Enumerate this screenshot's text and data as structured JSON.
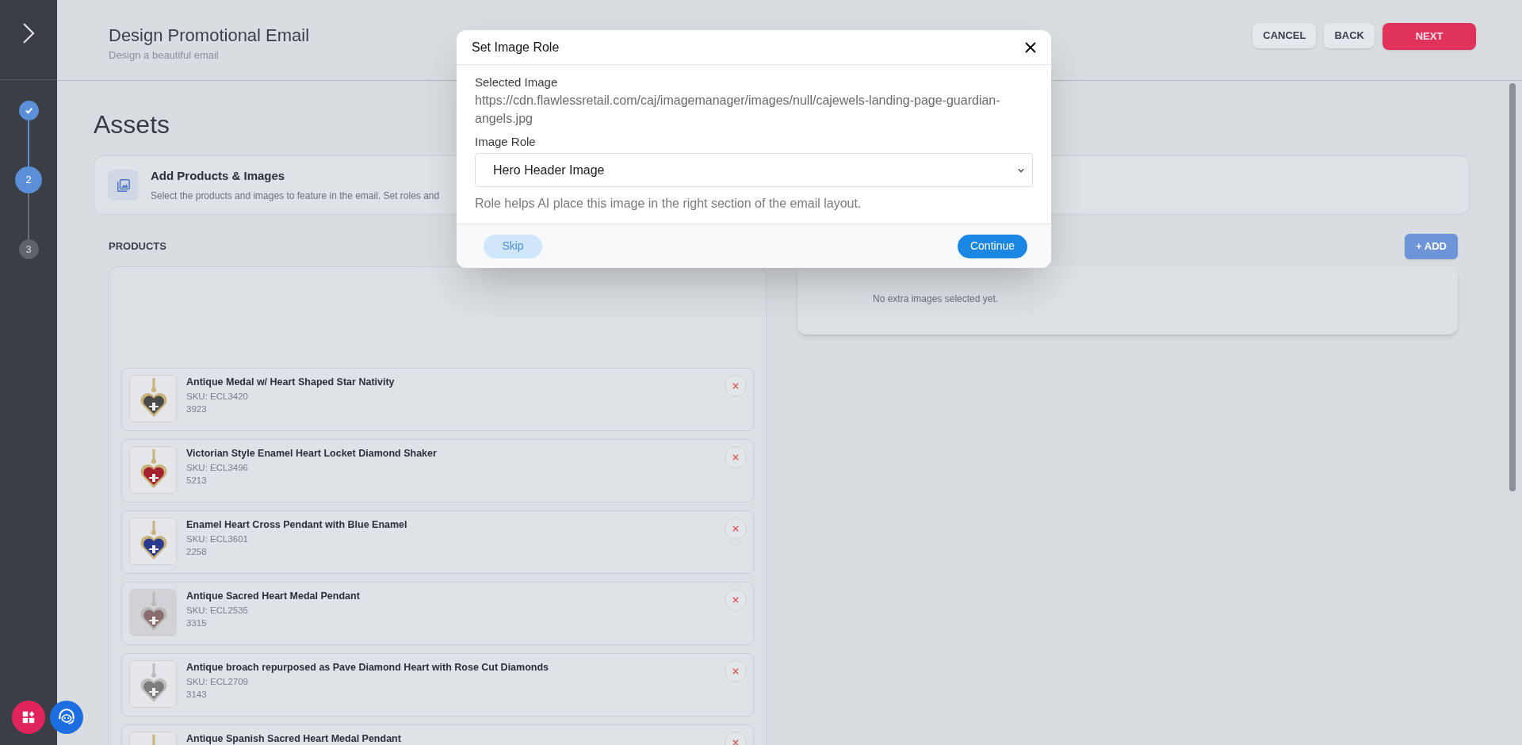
{
  "steps": [
    {
      "completed": true,
      "selected": false
    },
    {
      "label": "2",
      "completed": false,
      "selected": true
    },
    {
      "label": "3",
      "completed": false,
      "selected": false
    }
  ],
  "header": {
    "title": "Design Promotional Email",
    "subtitle": "Design a beautiful email",
    "buttons": [
      {
        "label": "CANCEL",
        "kind": "secondary"
      },
      {
        "label": "BACK",
        "kind": "secondary"
      },
      {
        "label": "NEXT",
        "kind": "primary"
      }
    ]
  },
  "page_title": "Assets",
  "info_card": {
    "title": "Add Products & Images",
    "description": "Select the products and images to feature in the email. Set roles and"
  },
  "products": {
    "heading": "PRODUCTS",
    "items": [
      {
        "name": "Antique Medal w/ Heart Shaped Star Nativity",
        "sku": "SKU: ECL3420",
        "code": "3923"
      },
      {
        "name": "Victorian Style Enamel Heart Locket Diamond Shaker",
        "sku": "SKU: ECL3496",
        "code": "5213"
      },
      {
        "name": "Enamel Heart Cross Pendant with Blue Enamel",
        "sku": "SKU: ECL3601",
        "code": "2258"
      },
      {
        "name": "Antique Sacred Heart Medal Pendant",
        "sku": "SKU: ECL2535",
        "code": "3315"
      },
      {
        "name": "Antique broach repurposed as Pave Diamond Heart with Rose Cut Diamonds",
        "sku": "SKU: ECL2709",
        "code": "3143"
      },
      {
        "name": "Antique Spanish Sacred Heart Medal Pendant"
      }
    ]
  },
  "images": {
    "add_button": "+ ADD",
    "empty_text": "No extra images selected yet."
  },
  "dialog": {
    "title": "Set Image Role",
    "selected_label": "Selected Image",
    "selected_value": "https://cdn.flawlessretail.com/caj/imagemanager/images/null/cajewels-landing-page-guardian-angels.jpg",
    "role_label": "Image Role",
    "role_value": "Hero Header Image",
    "hint": "Role helps AI place this image in the right section of the email layout.",
    "skip": "Skip",
    "continue": "Continue"
  }
}
